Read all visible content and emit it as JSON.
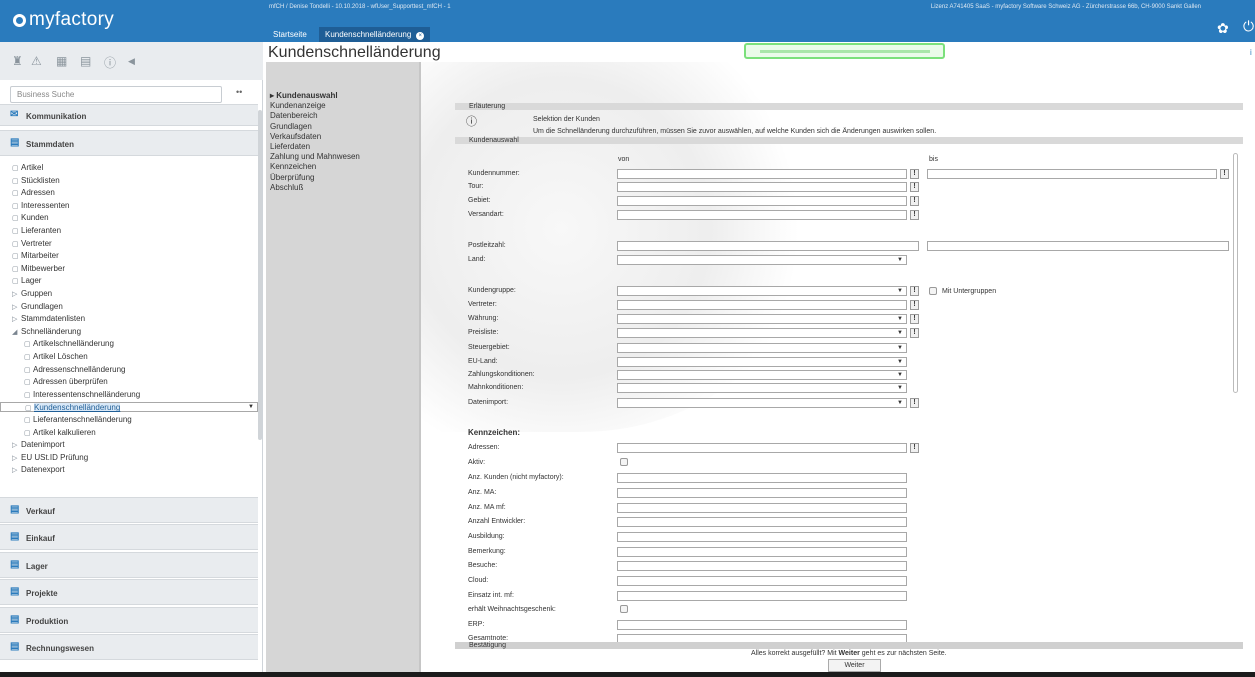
{
  "app": {
    "logo_text": "myfactory",
    "brand_color": "#2a7bbd"
  },
  "topbar": {
    "session_info": "mfCH / Denise Tondelli - 10.10.2018 - wfUser_Supporttest_mfCH - 1",
    "license_info": "Lizenz A741405 SaaS - myfactory Software Schweiz AG - Zürcherstrasse 66b, CH-9000 Sankt Gallen",
    "tabs": [
      {
        "label": "Startseite"
      },
      {
        "label": "Kundenschnelländerung",
        "close": "×"
      }
    ],
    "settings_icon": "gear-icon",
    "power_icon": "power-icon",
    "settings_glyph": "✿",
    "power_glyph": "⏻"
  },
  "sidebar": {
    "search_placeholder": "Business Suche",
    "search_dots": "••",
    "toolbar_icons": [
      "♜",
      "⚠",
      "▦",
      "▤",
      "ⓘ",
      "◀"
    ],
    "sections": [
      {
        "label": "Kommunikation",
        "icon": "✉"
      },
      {
        "label": "Stammdaten",
        "icon": "▤"
      },
      {
        "label": "Verkauf",
        "icon": "▤"
      },
      {
        "label": "Einkauf",
        "icon": "▤"
      },
      {
        "label": "Lager",
        "icon": "▤"
      },
      {
        "label": "Projekte",
        "icon": "▤"
      },
      {
        "label": "Produktion",
        "icon": "▤"
      },
      {
        "label": "Rechnungswesen",
        "icon": "▤"
      }
    ],
    "stammdaten_items": [
      {
        "label": "Artikel",
        "icon": "▢"
      },
      {
        "label": "Stücklisten",
        "icon": "▢"
      },
      {
        "label": "Adressen",
        "icon": "▢"
      },
      {
        "label": "Interessenten",
        "icon": "▢"
      },
      {
        "label": "Kunden",
        "icon": "▢"
      },
      {
        "label": "Lieferanten",
        "icon": "▢"
      },
      {
        "label": "Vertreter",
        "icon": "▢"
      },
      {
        "label": "Mitarbeiter",
        "icon": "▢"
      },
      {
        "label": "Mitbewerber",
        "icon": "▢"
      },
      {
        "label": "Lager",
        "icon": "▢"
      },
      {
        "label": "Gruppen",
        "icon": "▷"
      },
      {
        "label": "Grundlagen",
        "icon": "▷"
      },
      {
        "label": "Stammdatenlisten",
        "icon": "▷"
      },
      {
        "label": "Schnelländerung",
        "icon": "◢"
      },
      {
        "label": "Artikelschnelländerung",
        "icon": "▢"
      },
      {
        "label": "Artikel Löschen",
        "icon": "▢"
      },
      {
        "label": "Adressenschnelländerung",
        "icon": "▢"
      },
      {
        "label": "Adressen überprüfen",
        "icon": "▢"
      },
      {
        "label": "Interessentenschnelländerung",
        "icon": "▢"
      },
      {
        "label": "Kundenschnelländerung",
        "icon": "▢"
      },
      {
        "label": "Lieferantenschnelländerung",
        "icon": "▢"
      },
      {
        "label": "Artikel kalkulieren",
        "icon": "▢"
      },
      {
        "label": "Datenimport",
        "icon": "▷"
      },
      {
        "label": "EU USt.ID Prüfung",
        "icon": "▷"
      },
      {
        "label": "Datenexport",
        "icon": "▷"
      }
    ]
  },
  "page": {
    "title": "Kundenschnelländerung",
    "info_icon": "i"
  },
  "wizard": {
    "steps": [
      {
        "label": "Kundenauswahl",
        "active": true
      },
      {
        "label": "Kundenanzeige"
      },
      {
        "label": "Datenbereich"
      },
      {
        "label": "Grundlagen"
      },
      {
        "label": "Verkaufsdaten"
      },
      {
        "label": "Lieferdaten"
      },
      {
        "label": "Zahlung und Mahnwesen"
      },
      {
        "label": "Kennzeichen"
      },
      {
        "label": "Überprüfung"
      },
      {
        "label": "Abschluß"
      }
    ],
    "active_marker": "▸"
  },
  "form": {
    "erlaeuterung_title": "Erläuterung",
    "selektion_title": "Selektion der Kunden",
    "selektion_text": "Um die Schnelländerung durchzuführen, müssen Sie zuvor auswählen, auf welche Kunden sich die Änderungen auswirken sollen.",
    "kundenauswahl_title": "Kundenauswahl",
    "von": "von",
    "bis": "bis",
    "btn_glyph": "!",
    "fields": {
      "kundennummer": "Kundennummer:",
      "tour": "Tour:",
      "gebiet": "Gebiet:",
      "versandart": "Versandart:",
      "postleitzahl": "Postleitzahl:",
      "land": "Land:",
      "kundengruppe": "Kundengruppe:",
      "mit_untergruppen": "Mit Untergruppen",
      "vertreter": "Vertreter:",
      "waehrung": "Währung:",
      "preisliste": "Preisliste:",
      "steuergebiet": "Steuergebiet:",
      "eu_land": "EU-Land:",
      "zahlungskonditionen": "Zahlungskonditionen:",
      "mahnkonditionen": "Mahnkonditionen:",
      "datenimport": "Datenimport:"
    },
    "kennzeichen_title": "Kennzeichen:",
    "kennzeichen": {
      "adressen": "Adressen:",
      "aktiv": "Aktiv:",
      "anz_kunden": "Anz. Kunden (nicht myfactory):",
      "anz_ma": "Anz. MA:",
      "anz_ma_mf": "Anz. MA mf:",
      "anzahl_entwickler": "Anzahl Entwickler:",
      "ausbildung": "Ausbildung:",
      "bemerkung": "Bemerkung:",
      "besuche": "Besuche:",
      "cloud": "Cloud:",
      "einsatz_int_mf": "Einsatz int. mf:",
      "weihnachtsgeschenk": "erhält Weihnachtsgeschenk:",
      "erp": "ERP:",
      "gesamtnote": "Gesamtnote:"
    },
    "bestaetigung_title": "Bestätigung",
    "footer_pre": "Alles korrekt ausgefüllt? Mit",
    "footer_bold": "Weiter",
    "footer_post": "geht es zur nächsten Seite.",
    "weiter_button": "Weiter"
  }
}
